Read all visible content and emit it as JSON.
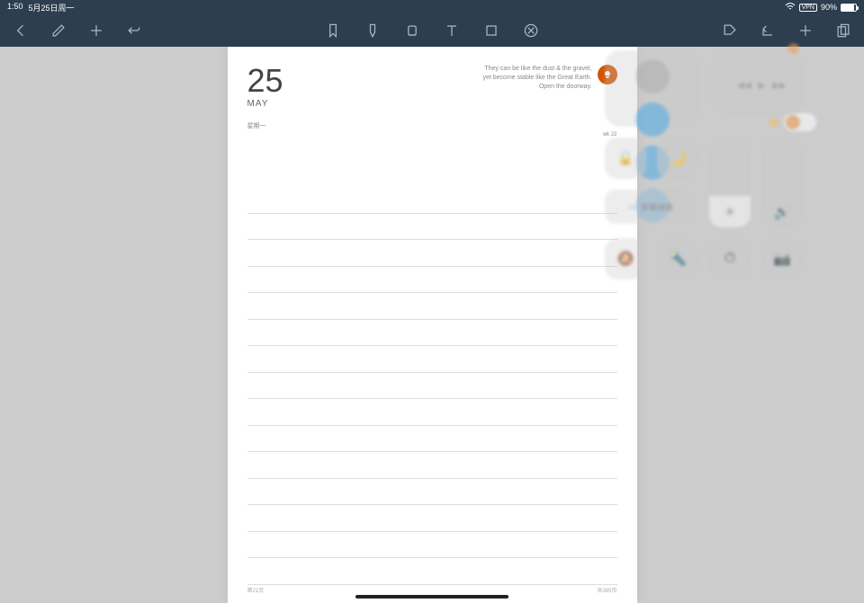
{
  "status_bar": {
    "time": "1:50",
    "date_label": "5月25日周一",
    "vpn_label": "VPN",
    "battery_percent": "90%"
  },
  "toolbar": {
    "back_label": "back",
    "pen_label": "pen",
    "add_label": "add",
    "undo_label": "undo",
    "bookmark_label": "bookmark",
    "highlighter_label": "highlighter",
    "eraser_label": "eraser",
    "text_label": "text",
    "shape_label": "shape",
    "more_label": "more",
    "tag_label": "tag",
    "rotate_label": "rotate",
    "plus_label": "plus",
    "pages_label": "pages"
  },
  "page": {
    "day": "25",
    "month": "MAY",
    "weekday": "星期一",
    "quote_line1": "They can be like the dust & the gravel,",
    "quote_line2": "yet become stable like the Great Earth.",
    "quote_line3": "Open the doorway.",
    "mid_right": "wk 22",
    "footer_left": "第21页",
    "footer_right": "共365页"
  },
  "control_center": {
    "mirror_label": "屏幕镜像"
  }
}
